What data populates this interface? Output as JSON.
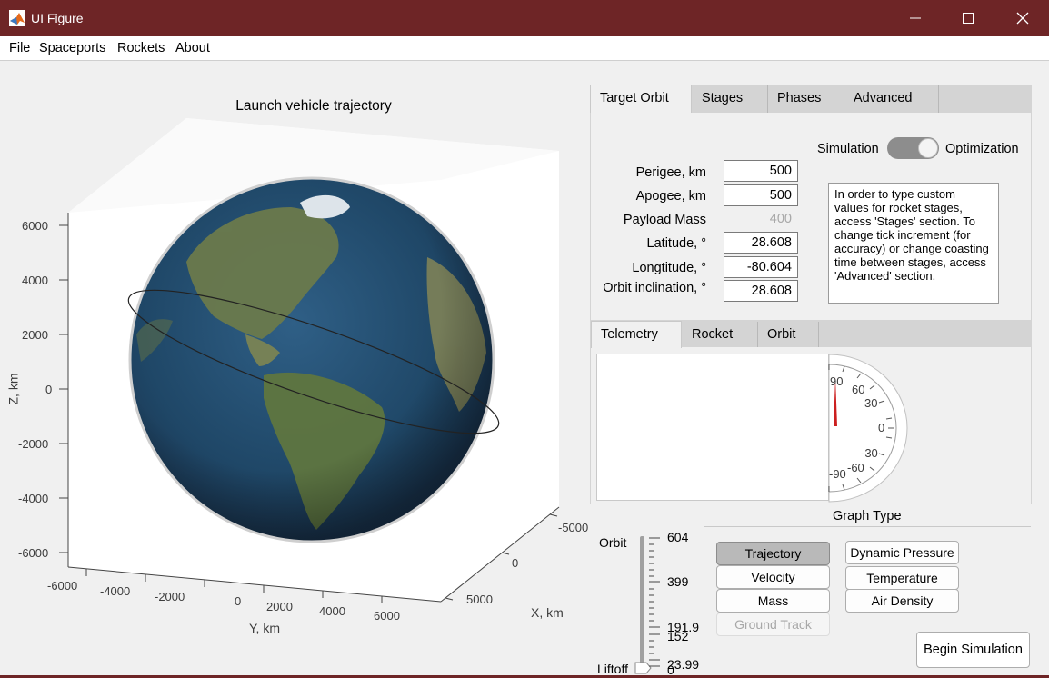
{
  "window": {
    "title": "UI Figure",
    "controls": {
      "minimize": "minimize-icon",
      "maximize": "maximize-icon",
      "close": "close-icon"
    }
  },
  "menu": [
    "File",
    "Spaceports",
    "Rockets",
    "About"
  ],
  "plot": {
    "title": "Launch vehicle trajectory",
    "z_label": "Z, km",
    "y_label": "Y, km",
    "x_label": "X, km",
    "z_ticks": [
      "6000",
      "4000",
      "2000",
      "0",
      "-2000",
      "-4000",
      "-6000"
    ],
    "y_ticks": [
      "-6000",
      "-4000",
      "-2000",
      "0",
      "2000",
      "4000",
      "6000"
    ],
    "x_ticks": [
      "-5000",
      "0",
      "5000"
    ]
  },
  "orbit_tabs": [
    "Target Orbit",
    "Stages",
    "Phases",
    "Advanced"
  ],
  "mode_switch": {
    "left": "Simulation",
    "right": "Optimization"
  },
  "form": {
    "perigee": {
      "label": "Perigee, km",
      "value": "500"
    },
    "apogee": {
      "label": "Apogee, km",
      "value": "500"
    },
    "payload": {
      "label": "Payload Mass",
      "value": "400"
    },
    "latitude": {
      "label": "Latitude, °",
      "value": "28.608"
    },
    "longitude": {
      "label": "Longtitude, °",
      "value": "-80.604"
    },
    "inclination": {
      "label": "Orbit inclination, °",
      "value": "28.608"
    }
  },
  "info_text": "In order to type custom values for rocket stages, access 'Stages' section. To change tick increment (for accuracy) or change coasting time between stages, access 'Advanced' section.",
  "telemetry_tabs": [
    "Telemetry",
    "Rocket",
    "Orbit"
  ],
  "gauge": {
    "labels": [
      "90",
      "60",
      "30",
      "0",
      "-30",
      "-60",
      "-90"
    ],
    "needle_value": 90,
    "range": [
      -90,
      90
    ]
  },
  "graph_type": {
    "title": "Graph Type",
    "buttons": [
      "Trajectory",
      "Velocity",
      "Mass",
      "Ground Track",
      "Dynamic Pressure",
      "Temperature",
      "Air Density"
    ],
    "selected": "Trajectory",
    "disabled": "Ground Track"
  },
  "altitude_slider": {
    "top_label": "Orbit",
    "bottom_label": "Liftoff",
    "ticks": [
      "604",
      "399",
      "191.9",
      "152",
      "23.99",
      "0"
    ],
    "value": 0
  },
  "begin_button": "Begin Simulation"
}
